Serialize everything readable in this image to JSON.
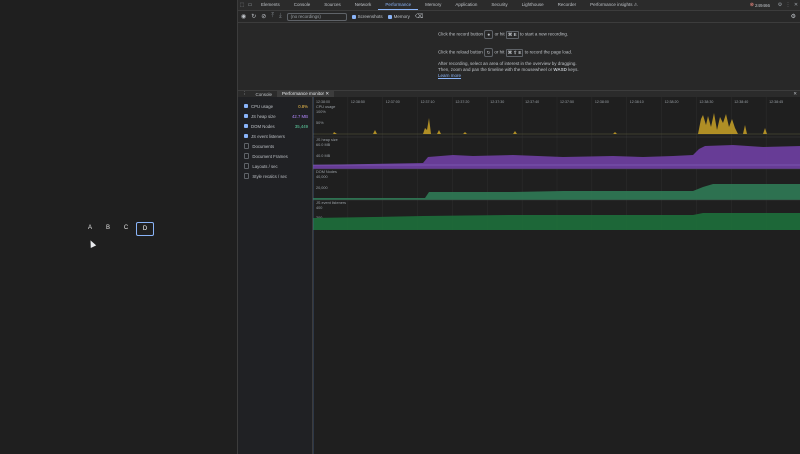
{
  "page": {
    "buttons": [
      {
        "label": "A",
        "active": false
      },
      {
        "label": "B",
        "active": false
      },
      {
        "label": "C",
        "active": false
      },
      {
        "label": "D",
        "active": true
      }
    ]
  },
  "devtools": {
    "tabs": [
      "Elements",
      "Console",
      "Sources",
      "Network",
      "Performance",
      "Memory",
      "Application",
      "Security",
      "Lighthouse",
      "Recorder",
      "Performance insights ⚠"
    ],
    "selected_tab": "Performance",
    "error_count": "249466",
    "toolbar": {
      "select_placeholder": "(no recordings)",
      "screenshots_label": "Screenshots",
      "memory_label": "Memory"
    },
    "landing": {
      "line1_pre": "Click the record button",
      "line1_icon": "⏺",
      "line1_mid": "or hit",
      "line1_key": "⌘ E",
      "line1_post": "to start a new recording.",
      "line2_pre": "Click the reload button",
      "line2_icon": "↻",
      "line2_mid": "or hit",
      "line2_key": "⌘ ⇧ E",
      "line2_post": "to record the page load.",
      "line3": "After recording, select an area of interest in the overview by dragging.",
      "line4_pre": "Then, zoom and pan the timeline with the mousewheel or",
      "line4_key": "WASD",
      "line4_post": "keys.",
      "learn_more": "Learn more"
    },
    "drawer": {
      "tabs": [
        "Console",
        "Performance monitor"
      ],
      "selected": "Performance monitor"
    },
    "metrics": [
      {
        "label": "CPU usage",
        "value": "0.8%",
        "checked": true,
        "color": "#f2c14e"
      },
      {
        "label": "JS heap size",
        "value": "42.7 MB",
        "checked": true,
        "color": "#b388ff"
      },
      {
        "label": "DOM Nodes",
        "value": "35,449",
        "checked": true,
        "color": "#5fd1a3"
      },
      {
        "label": "JS event listeners",
        "value": "",
        "checked": true,
        "color": "#4ec27a"
      },
      {
        "label": "Documents",
        "value": "",
        "checked": false,
        "color": "#9aa0a6"
      },
      {
        "label": "Document Frames",
        "value": "",
        "checked": false,
        "color": "#9aa0a6"
      },
      {
        "label": "Layouts / sec",
        "value": "",
        "checked": false,
        "color": "#9aa0a6"
      },
      {
        "label": "Style recalcs / sec",
        "value": "",
        "checked": false,
        "color": "#9aa0a6"
      }
    ],
    "timeline_ticks": [
      "12:38:00",
      "12:38:50",
      "12:37:00",
      "12:37:10",
      "12:37:20",
      "12:37:30",
      "12:37:40",
      "12:37:50",
      "12:38:00",
      "12:38:10",
      "12:38:20",
      "12:38:30",
      "12:38:40",
      "12:38:45"
    ],
    "chart_labels": {
      "cpu": "CPU usage",
      "cpu_scale": "100%",
      "cpu_mid": "50%",
      "heap": "JS heap size",
      "heap_scale": "60.0 MB",
      "heap_mid": "40.0 MB",
      "dom": "DOM Nodes",
      "dom_scale": "40,000",
      "dom_mid": "20,000",
      "listeners": "JS event listeners",
      "listeners_scale": "400",
      "listeners_mid": "200"
    }
  }
}
